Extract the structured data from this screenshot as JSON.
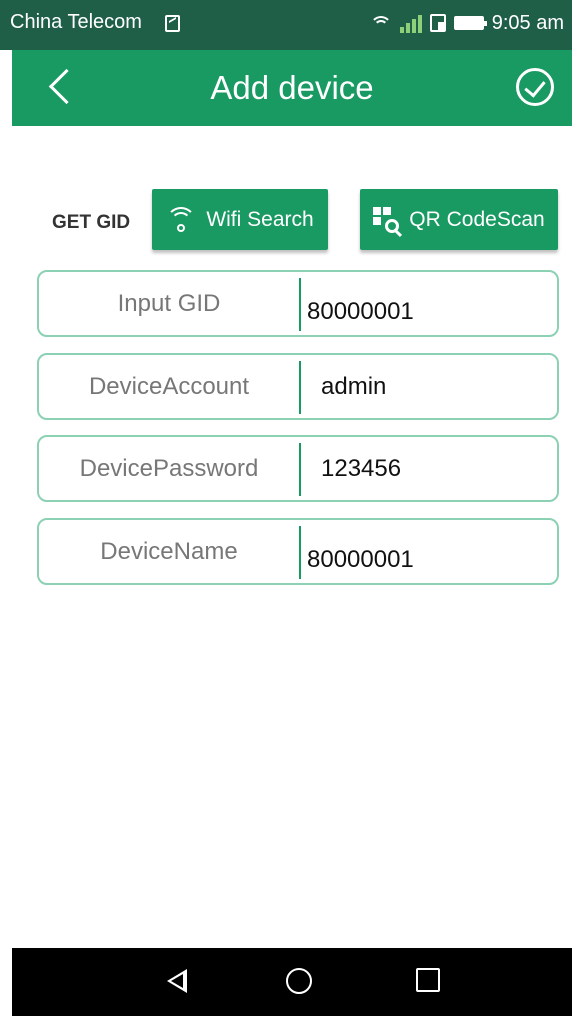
{
  "status_bar": {
    "carrier": "China Telecom",
    "time": "9:05 am",
    "icons": [
      "sim-icon",
      "wifi-icon",
      "signal-icon",
      "phone-icon",
      "battery-icon"
    ]
  },
  "header": {
    "title": "Add device",
    "back_icon": "chevron-left-icon",
    "confirm_icon": "check-circle-icon"
  },
  "gid": {
    "label": "GET GID",
    "wifi_button_label": "Wifi Search",
    "qr_button_label": "QR CodeScan"
  },
  "fields": [
    {
      "label": "Input GID",
      "value": "80000001"
    },
    {
      "label": "DeviceAccount",
      "value": "admin"
    },
    {
      "label": "DevicePassword",
      "value": "123456"
    },
    {
      "label": "DeviceName",
      "value": "80000001"
    }
  ],
  "colors": {
    "primary": "#1a9a63",
    "status_bar": "#1f5f48",
    "field_border": "#8cd1b4"
  }
}
